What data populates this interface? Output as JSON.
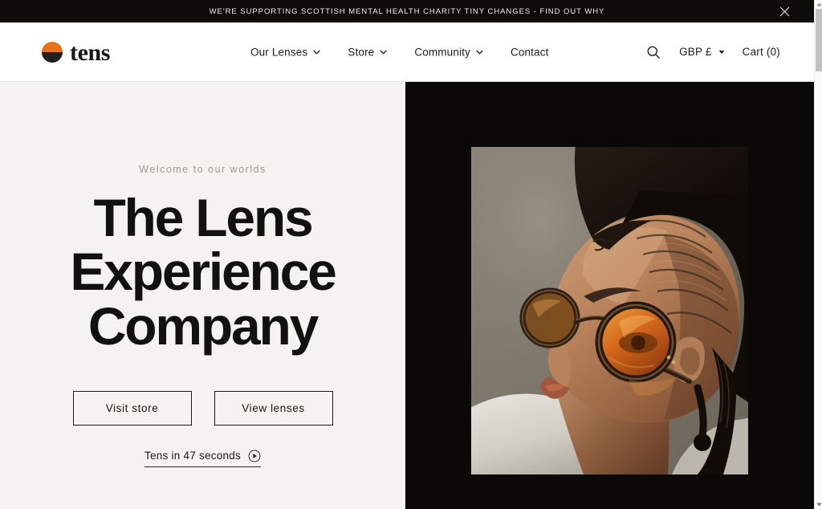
{
  "announcement": {
    "text": "WE'RE SUPPORTING SCOTTISH MENTAL HEALTH CHARITY TINY CHANGES - FIND OUT WHY",
    "close_icon": "close-icon",
    "background": "#0d0c0b"
  },
  "header": {
    "logo": {
      "wordmark": "tens",
      "mark_top_color": "#e8731a",
      "mark_bottom_color": "#231f1c"
    },
    "nav": [
      {
        "label": "Our Lenses",
        "has_dropdown": true
      },
      {
        "label": "Store",
        "has_dropdown": true
      },
      {
        "label": "Community",
        "has_dropdown": true
      },
      {
        "label": "Contact",
        "has_dropdown": false
      }
    ],
    "search_icon": "search-icon",
    "currency": {
      "label": "GBP £",
      "has_dropdown": true
    },
    "cart": {
      "label": "Cart",
      "count": "(0)",
      "full_label": "Cart  (0)"
    }
  },
  "hero": {
    "eyebrow": "Welcome to our worlds",
    "headline_lines": [
      "The Lens",
      "Experience",
      "Company"
    ],
    "headline": "The Lens Experience Company",
    "buttons": [
      {
        "label": "Visit store"
      },
      {
        "label": "View lenses"
      }
    ],
    "video_link": {
      "label": "Tens in 47 seconds",
      "icon": "play-circle-icon"
    },
    "left_background": "#f4f3ef",
    "right_background": "#0a0908",
    "image_alt": "Portrait of a woman with braided hair wearing round tortoiseshell sunglasses with orange tinted lenses"
  }
}
